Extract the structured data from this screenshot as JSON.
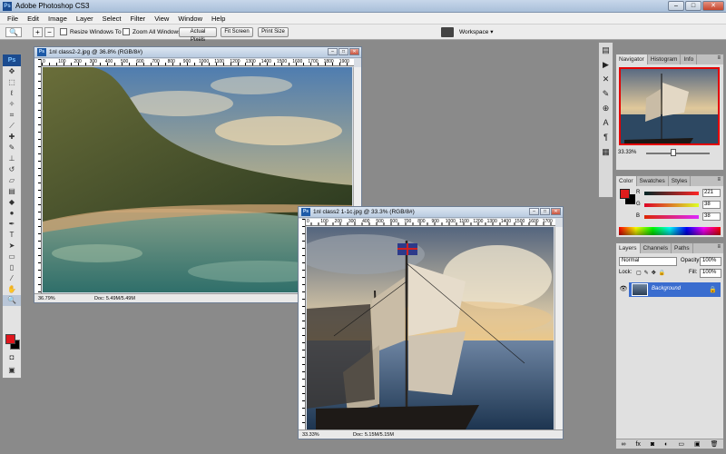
{
  "app": {
    "title": "Adobe Photoshop CS3",
    "logo": "Ps"
  },
  "window_controls": {
    "minimize": "–",
    "maximize": "□",
    "close": "✕"
  },
  "menu": [
    "File",
    "Edit",
    "Image",
    "Layer",
    "Select",
    "Filter",
    "View",
    "Window",
    "Help"
  ],
  "options_bar": {
    "zoom_icon": "magnifier-icon",
    "zoom_in": "+",
    "zoom_out": "−",
    "resize_windows": "Resize Windows To Fit",
    "zoom_all_windows": "Zoom All Windows",
    "actual_pixels": "Actual Pixels",
    "fit_screen": "Fit Screen",
    "print_size": "Print Size",
    "workspace": "Workspace ▾"
  },
  "documents": [
    {
      "title": "1nl class2-2.jpg @ 36.8% (RGB/8#)",
      "zoom": "36.79%",
      "doc_size": "Doc: 5.49M/5.49M",
      "ruler_labels": [
        "0",
        "100",
        "200",
        "300",
        "400",
        "500",
        "600",
        "700",
        "800",
        "900",
        "1000",
        "1100",
        "1200",
        "1300",
        "1400",
        "1500",
        "1600",
        "1700",
        "1800",
        "1900"
      ]
    },
    {
      "title": "1nl class2 1-1c.jpg @ 33.3% (RGB/8#)",
      "zoom": "33.33%",
      "doc_size": "Doc: 5.15M/5.15M",
      "ruler_labels": [
        "0",
        "100",
        "200",
        "300",
        "400",
        "500",
        "600",
        "700",
        "800",
        "900",
        "1000",
        "1100",
        "1200",
        "1300",
        "1400",
        "1500",
        "1600",
        "1700"
      ]
    }
  ],
  "panels": {
    "navigator": {
      "tabs": [
        "Navigator",
        "Histogram",
        "Info"
      ],
      "zoom": "33.33%"
    },
    "color": {
      "tabs": [
        "Color",
        "Swatches",
        "Styles"
      ],
      "r_label": "R",
      "g_label": "G",
      "b_label": "B",
      "r": "221",
      "g": "38",
      "b": "38",
      "fg_color": "#dd2626",
      "bg_color": "#000000"
    },
    "layers": {
      "tabs": [
        "Layers",
        "Channels",
        "Paths"
      ],
      "blend_mode": "Normal",
      "opacity_label": "Opacity:",
      "opacity": "100%",
      "lock_label": "Lock:",
      "fill_label": "Fill:",
      "fill": "100%",
      "layer_name": "Background"
    }
  },
  "colors": {
    "accent": "#3a6dcf",
    "foreground": "#e0161d"
  }
}
